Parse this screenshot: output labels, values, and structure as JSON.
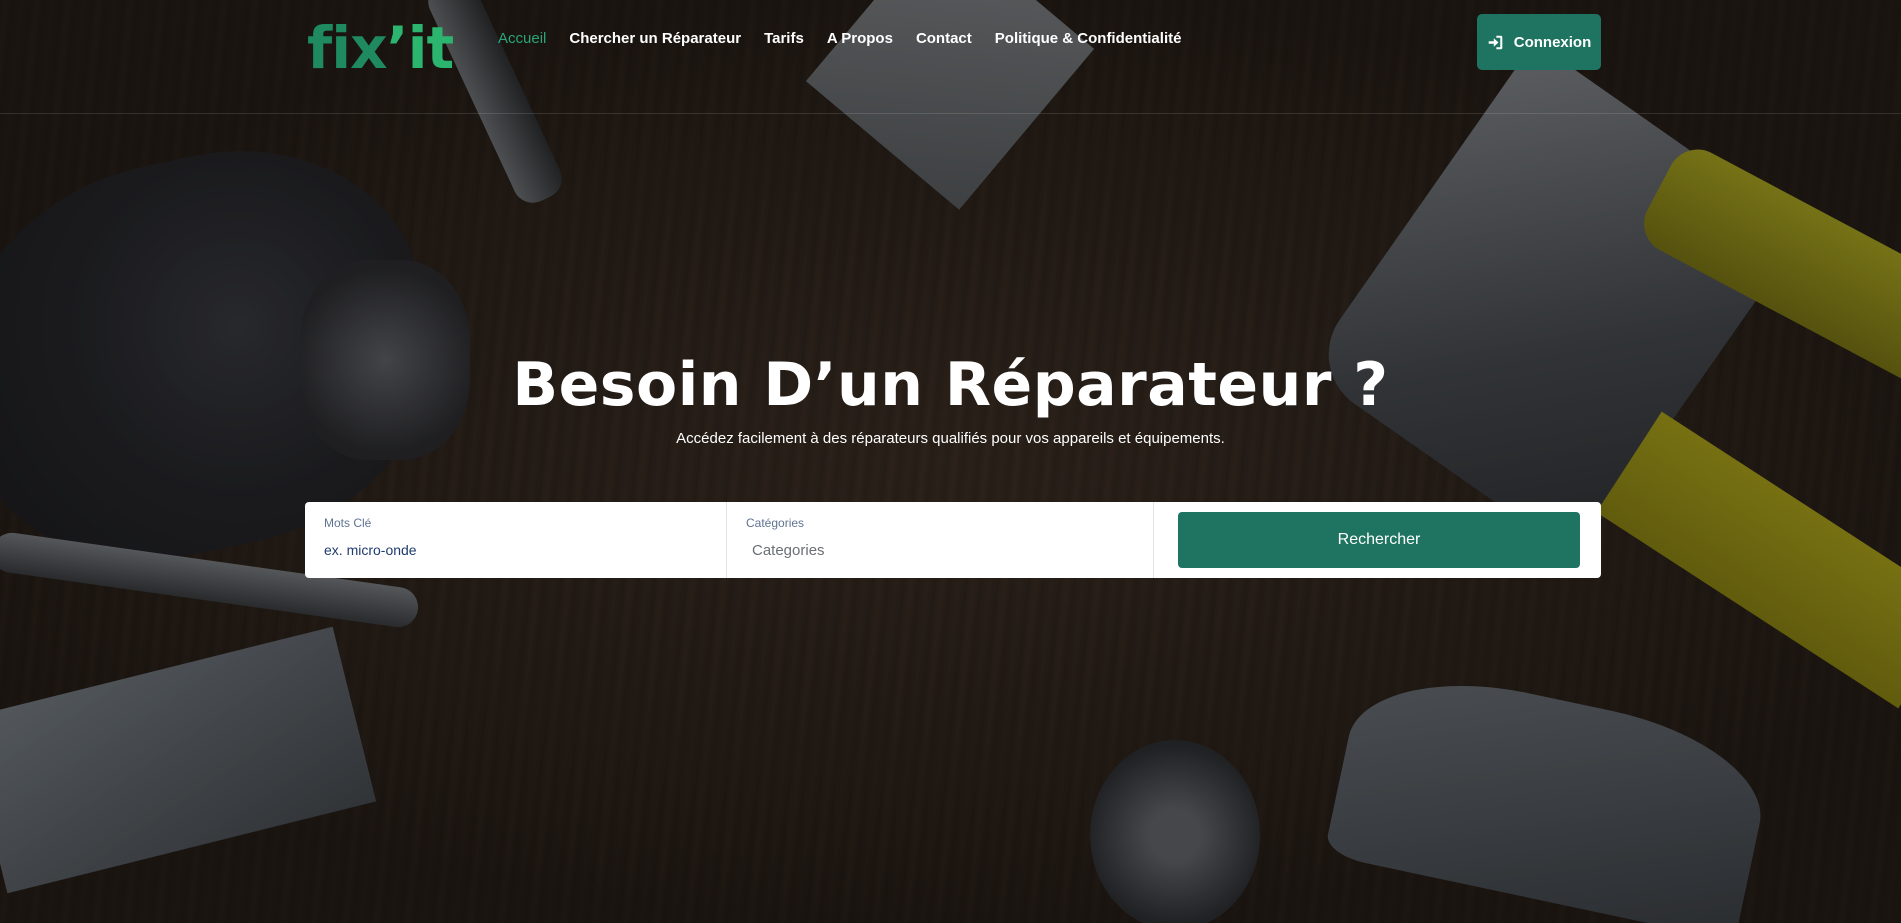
{
  "brand": {
    "logo_part1": "fix",
    "logo_part2": "’it"
  },
  "nav": {
    "items": [
      {
        "label": "Accueil",
        "active": true
      },
      {
        "label": "Chercher un Réparateur"
      },
      {
        "label": "Tarifs"
      },
      {
        "label": "A Propos"
      },
      {
        "label": "Contact"
      },
      {
        "label": "Politique & Confidentialité"
      }
    ]
  },
  "login": {
    "label": "Connexion",
    "icon": "sign-in-icon"
  },
  "hero": {
    "title": "Besoin D’un Réparateur ?",
    "subtitle": "Accédez facilement à des réparateurs qualifiés pour vos appareils et équipements."
  },
  "search": {
    "keywords_label": "Mots Clé",
    "keywords_placeholder": "ex. micro-onde",
    "category_label": "Catégories",
    "category_value": "Categories",
    "submit_label": "Rechercher"
  },
  "colors": {
    "brand_green": "#1e7461",
    "accent_green": "#2aa577"
  }
}
